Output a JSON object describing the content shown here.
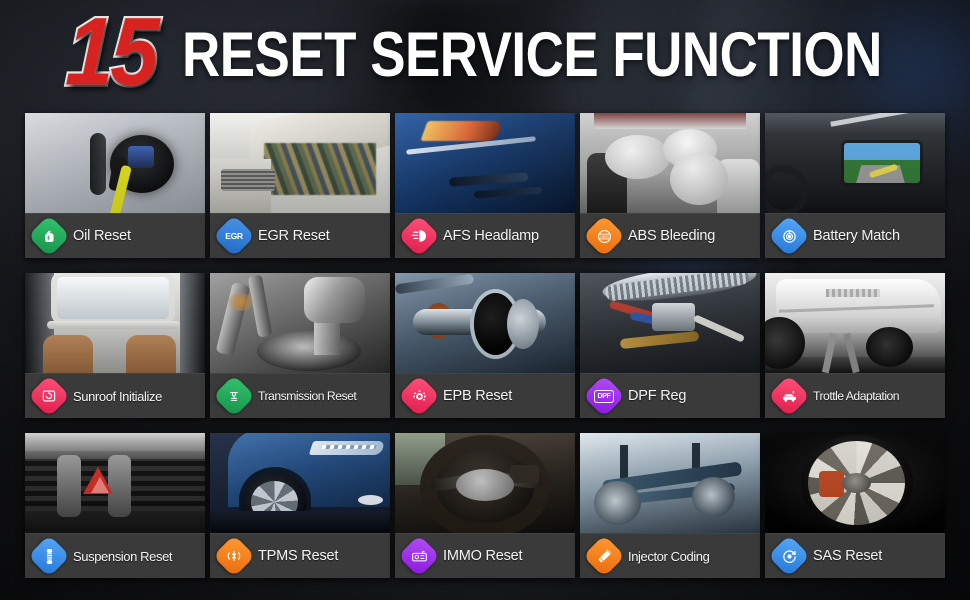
{
  "header": {
    "number": "15",
    "title": "RESET SERVICE FUNCTION",
    "number_color": "#d8221f",
    "title_color": "#ffffff"
  },
  "background_color": "#121316",
  "cards": [
    {
      "label": "Oil Reset",
      "icon": "oil-can-icon",
      "icon_color": "#26a65b",
      "photo": "ev-charging-port"
    },
    {
      "label": "EGR Reset",
      "icon": "egr-text-icon",
      "icon_color": "#2f7fd6",
      "photo": "open-engine-bay"
    },
    {
      "label": "AFS Headlamp",
      "icon": "headlamp-icon",
      "icon_color": "#f0365e",
      "photo": "blue-car-headlight"
    },
    {
      "label": "ABS Bleeding",
      "icon": "abs-brake-icon",
      "icon_color": "#f58220",
      "photo": "deployed-airbags"
    },
    {
      "label": "Battery Match",
      "icon": "battery-match-icon",
      "icon_color": "#3b93ef",
      "photo": "dashboard-nav-screen"
    },
    {
      "label": "Sunroof Initialize",
      "icon": "sunroof-icon",
      "icon_color": "#f0365e",
      "photo": "panoramic-sunroof-cabin"
    },
    {
      "label": "Transmission Reset",
      "icon": "transmission-gear-icon",
      "icon_color": "#26a65b",
      "photo": "chrome-gear-shifter"
    },
    {
      "label": "EPB Reset",
      "icon": "epb-gear-icon",
      "icon_color": "#f0365e",
      "photo": "driveshaft-assembly"
    },
    {
      "label": "DPF Reg",
      "icon": "dpf-text-icon",
      "icon_color": "#a02ff0",
      "photo": "engine-air-cleaner"
    },
    {
      "label": "Trottle Adaptation",
      "icon": "throttle-car-icon",
      "icon_color": "#f0365e",
      "photo": "white-car-on-lift"
    },
    {
      "label": "Suspension Reset",
      "icon": "suspension-icon",
      "icon_color": "#3b93ef",
      "photo": "dash-vents-hazard-button"
    },
    {
      "label": "TPMS Reset",
      "icon": "tpms-icon",
      "icon_color": "#f58220",
      "photo": "blue-car-wheel"
    },
    {
      "label": "IMMO Reset",
      "icon": "immo-key-icon",
      "icon_color": "#a02ff0",
      "photo": "steering-wheel"
    },
    {
      "label": "Injector Coding",
      "icon": "injector-icon",
      "icon_color": "#f58220",
      "photo": "chassis-render"
    },
    {
      "label": "SAS Reset",
      "icon": "sas-steering-icon",
      "icon_color": "#3b93ef",
      "photo": "alloy-wheel"
    }
  ]
}
